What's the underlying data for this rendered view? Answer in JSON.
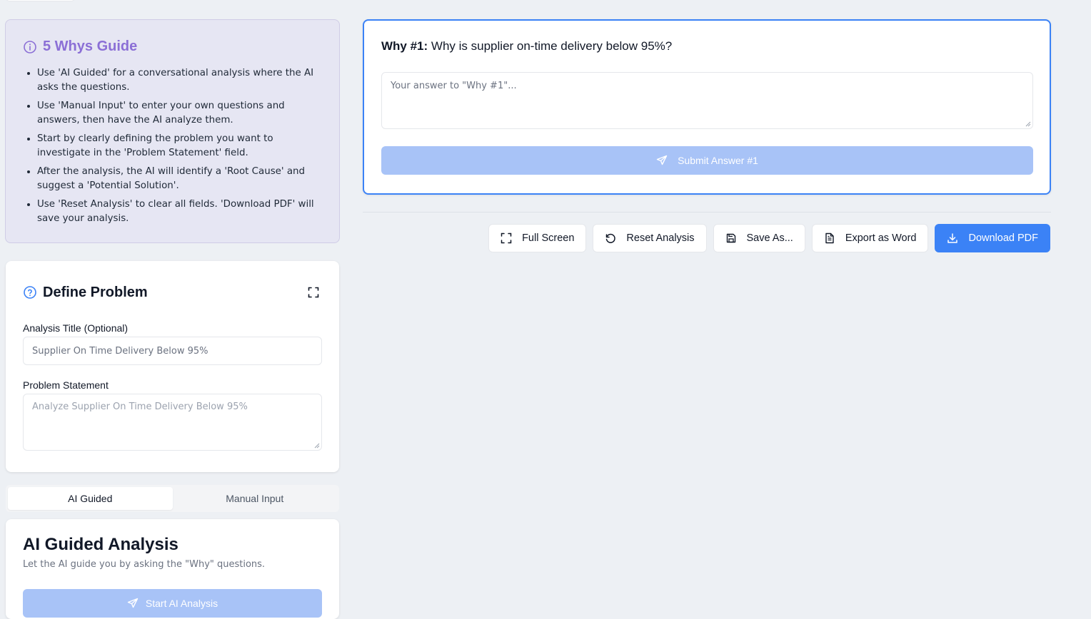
{
  "guide": {
    "title": "5 Whys Guide",
    "items": [
      "Use 'AI Guided' for a conversational analysis where the AI asks the questions.",
      "Use 'Manual Input' to enter your own questions and answers, then have the AI analyze them.",
      "Start by clearly defining the problem you want to investigate in the 'Problem Statement' field.",
      "After the analysis, the AI will identify a 'Root Cause' and suggest a 'Potential Solution'.",
      "Use 'Reset Analysis' to clear all fields. 'Download PDF' will save your analysis."
    ]
  },
  "define": {
    "title": "Define Problem",
    "analysis_title_label": "Analysis Title (Optional)",
    "analysis_title_placeholder": "Supplier On Time Delivery Below 95%",
    "problem_statement_label": "Problem Statement",
    "problem_statement_placeholder": "Analyze Supplier On Time Delivery Below 95%"
  },
  "tabs": [
    {
      "label": "AI Guided",
      "active": true
    },
    {
      "label": "Manual Input",
      "active": false
    }
  ],
  "ai_guided": {
    "title": "AI Guided Analysis",
    "subtitle": "Let the AI guide you by asking the \"Why\" questions.",
    "start_label": "Start AI Analysis"
  },
  "why": {
    "number_label": "Why #1:",
    "question": "Why is supplier on-time delivery below 95%?",
    "answer_placeholder": "Your answer to \"Why #1\"...",
    "submit_label": "Submit Answer #1"
  },
  "toolbar": {
    "full_screen": "Full Screen",
    "reset": "Reset Analysis",
    "save_as": "Save As...",
    "export_word": "Export as Word",
    "download_pdf": "Download PDF"
  },
  "colors": {
    "accent": "#3b82f6",
    "accent_disabled": "#a8c3f7",
    "guide_bg": "#e6e6f3",
    "guide_title": "#8b6fd6"
  }
}
